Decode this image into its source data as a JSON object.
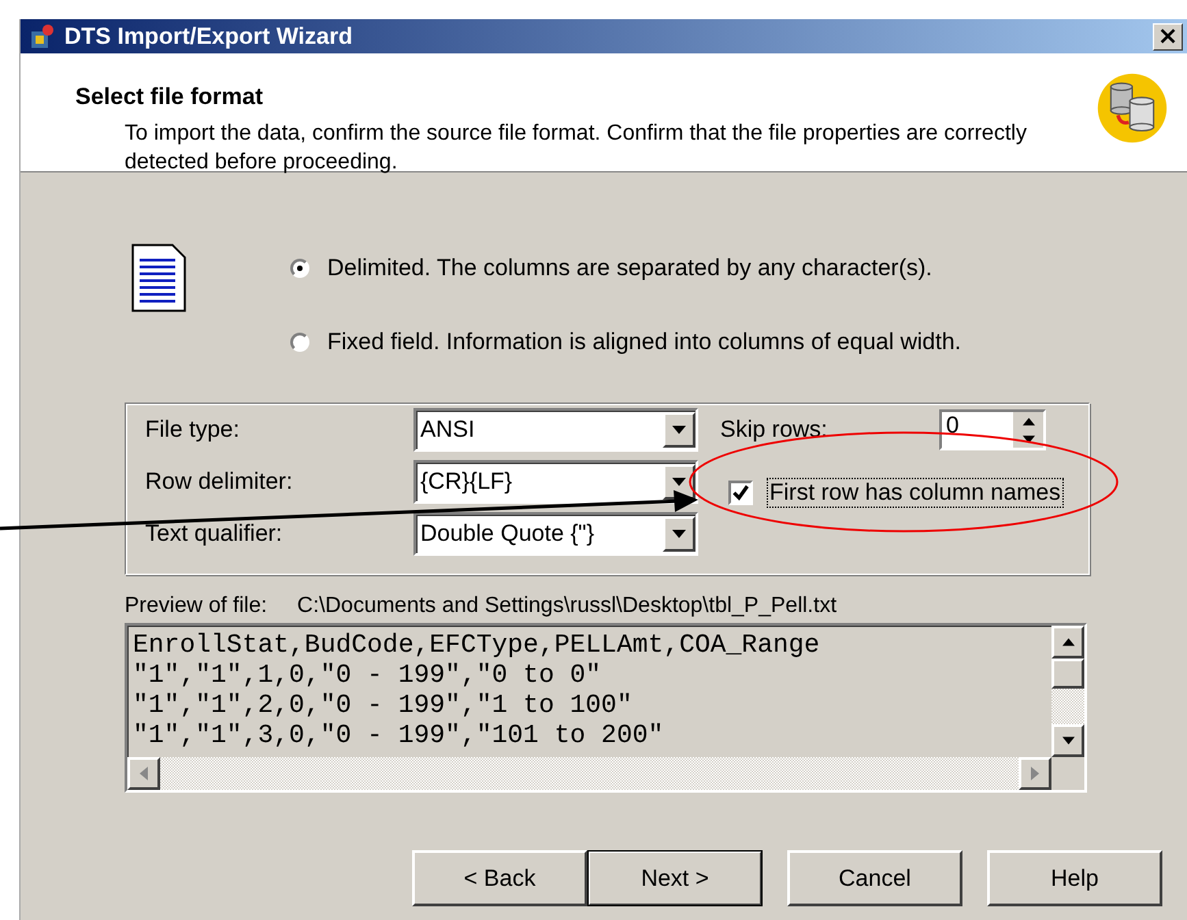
{
  "window": {
    "title": "DTS Import/Export Wizard",
    "close": "×"
  },
  "header": {
    "title": "Select file format",
    "description": "To import the data, confirm the source file format.  Confirm that the file properties are correctly detected before proceeding."
  },
  "format_options": [
    {
      "label": "Delimited.  The columns are separated by any character(s).",
      "selected": true
    },
    {
      "label": "Fixed field.  Information is aligned into columns of equal width.",
      "selected": false
    }
  ],
  "file_properties": {
    "fields": [
      {
        "label": "File type:",
        "value": "ANSI"
      },
      {
        "label": "Row delimiter:",
        "value": "{CR}{LF}"
      },
      {
        "label": "Text qualifier:",
        "value": "Double Quote {\"}"
      }
    ],
    "skip_rows": {
      "label": "Skip rows:",
      "value": "0"
    },
    "first_row_checkbox": {
      "label": "First row has column names",
      "checked": true
    }
  },
  "preview": {
    "label": "Preview of file:",
    "path": "C:\\Documents and Settings\\russl\\Desktop\\tbl_P_Pell.txt",
    "lines": [
      "EnrollStat,BudCode,EFCType,PELLAmt,COA_Range",
      "\"1\",\"1\",1,0,\"0 - 199\",\"0 to 0\"",
      "\"1\",\"1\",2,0,\"0 - 199\",\"1 to 100\"",
      "\"1\",\"1\",3,0,\"0 - 199\",\"101 to 200\""
    ]
  },
  "buttons": [
    {
      "label": "< Back",
      "default": false
    },
    {
      "label": "Next >",
      "default": true
    },
    {
      "label": "Cancel",
      "default": false
    },
    {
      "label": "Help",
      "default": false
    }
  ]
}
